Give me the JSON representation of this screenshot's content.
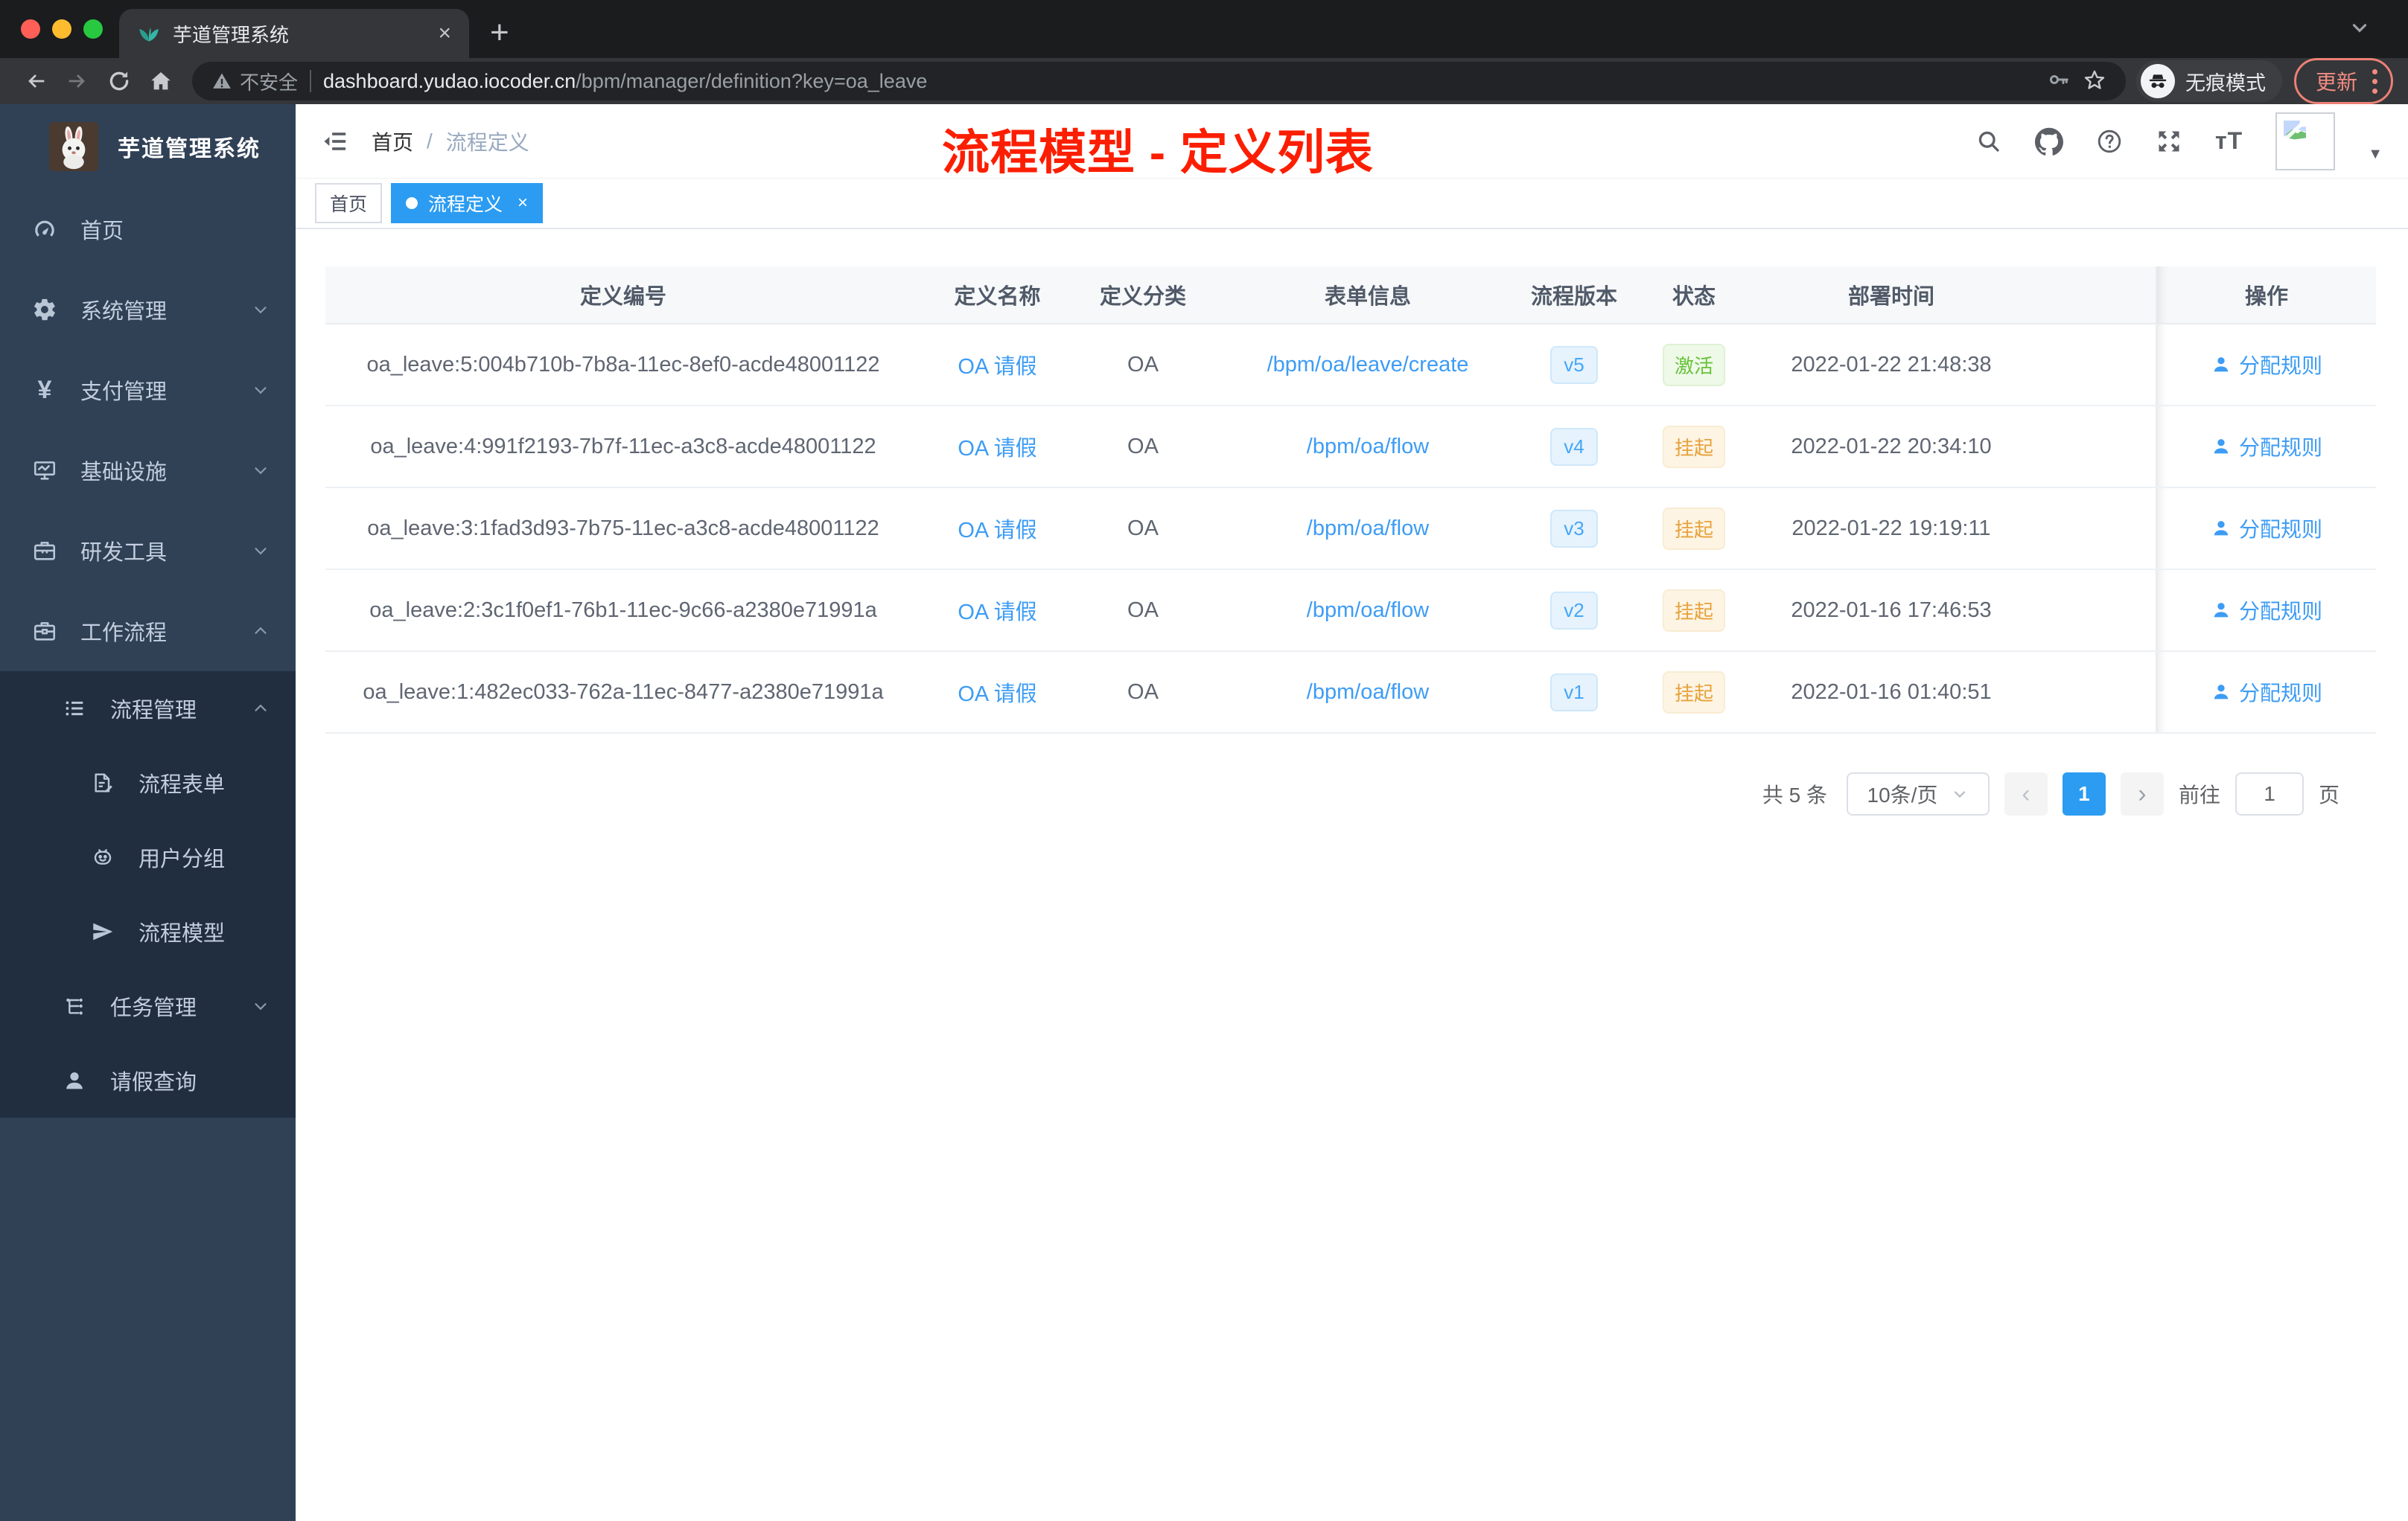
{
  "colors": {
    "accent_blue": "#409eff",
    "tag_active_blue": "#2b9cf2",
    "success_green": "#67c23a",
    "warning_orange": "#e6a23c",
    "annotation_red": "#fc1e00",
    "sidebar_bg": "#304156",
    "sidebar_submenu_bg": "#202e3f"
  },
  "browser": {
    "tab": {
      "title": "芋道管理系统",
      "close": "×",
      "new_tab": "+"
    },
    "toolbar": {
      "security_label": "不安全",
      "url_host": "dashboard.yudao.iocoder.cn",
      "url_path": "/bpm/manager/definition?key=oa_leave",
      "incognito_label": "无痕模式",
      "update_label": "更新"
    }
  },
  "sidebar": {
    "logo_title": "芋道管理系统",
    "items": [
      {
        "label": "首页"
      },
      {
        "label": "系统管理"
      },
      {
        "label": "支付管理"
      },
      {
        "label": "基础设施"
      },
      {
        "label": "研发工具"
      },
      {
        "label": "工作流程"
      }
    ],
    "sub_items": [
      {
        "label": "流程管理"
      },
      {
        "label": "流程表单"
      },
      {
        "label": "用户分组"
      },
      {
        "label": "流程模型"
      },
      {
        "label": "任务管理"
      },
      {
        "label": "请假查询"
      }
    ]
  },
  "header": {
    "breadcrumb": {
      "home": "首页",
      "separator": "/",
      "current": "流程定义"
    },
    "annotation": "流程模型 - 定义列表"
  },
  "tags": {
    "home": "首页",
    "active": "流程定义",
    "close": "×"
  },
  "table": {
    "columns": [
      "定义编号",
      "定义名称",
      "定义分类",
      "表单信息",
      "流程版本",
      "状态",
      "部署时间",
      "操作"
    ],
    "rows": [
      {
        "id": "oa_leave:5:004b710b-7b8a-11ec-8ef0-acde48001122",
        "name": "OA 请假",
        "category": "OA",
        "form": "/bpm/oa/leave/create",
        "version": "v5",
        "status": "激活",
        "time": "2022-01-22 21:48:38",
        "action": "分配规则"
      },
      {
        "id": "oa_leave:4:991f2193-7b7f-11ec-a3c8-acde48001122",
        "name": "OA 请假",
        "category": "OA",
        "form": "/bpm/oa/flow",
        "version": "v4",
        "status": "挂起",
        "time": "2022-01-22 20:34:10",
        "action": "分配规则"
      },
      {
        "id": "oa_leave:3:1fad3d93-7b75-11ec-a3c8-acde48001122",
        "name": "OA 请假",
        "category": "OA",
        "form": "/bpm/oa/flow",
        "version": "v3",
        "status": "挂起",
        "time": "2022-01-22 19:19:11",
        "action": "分配规则"
      },
      {
        "id": "oa_leave:2:3c1f0ef1-76b1-11ec-9c66-a2380e71991a",
        "name": "OA 请假",
        "category": "OA",
        "form": "/bpm/oa/flow",
        "version": "v2",
        "status": "挂起",
        "time": "2022-01-16 17:46:53",
        "action": "分配规则"
      },
      {
        "id": "oa_leave:1:482ec033-762a-11ec-8477-a2380e71991a",
        "name": "OA 请假",
        "category": "OA",
        "form": "/bpm/oa/flow",
        "version": "v1",
        "status": "挂起",
        "time": "2022-01-16 01:40:51",
        "action": "分配规则"
      }
    ]
  },
  "pagination": {
    "total": "共 5 条",
    "page_size": "10条/页",
    "prev": "‹",
    "page": "1",
    "next": "›",
    "goto_label": "前往",
    "goto_value": "1",
    "page_unit": "页"
  }
}
